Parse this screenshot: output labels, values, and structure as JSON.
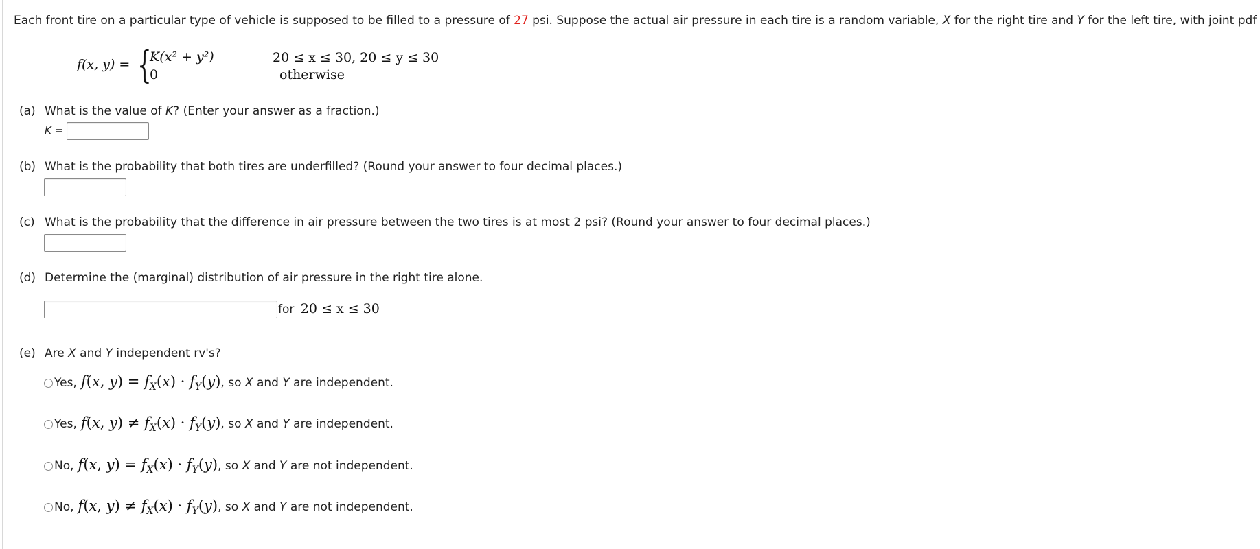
{
  "intro": {
    "before": "Each front tire on a particular type of vehicle is supposed to be filled to a pressure of ",
    "pressure": "27",
    "middle": " psi. Suppose the actual air pressure in each tire is a random variable, ",
    "var_x": "X",
    "after_x": " for the right tire and ",
    "var_y": "Y",
    "after_y": " for the left tire, with joint pdf"
  },
  "formula": {
    "lhs": "f(x, y) =",
    "case1_expr": "K(x² + y²)",
    "case1_cond": "20 ≤ x ≤ 30, 20 ≤ y ≤ 30",
    "case2_expr": "0",
    "case2_cond": "otherwise"
  },
  "parts": {
    "a": {
      "tag": "(a)",
      "q_before": "What is the value of ",
      "q_var": "K",
      "q_after": "? (Enter your answer as a fraction.)",
      "input_label_var": "K",
      "input_label_eq": " =",
      "value": ""
    },
    "b": {
      "tag": "(b)",
      "question": "What is the probability that both tires are underfilled? (Round your answer to four decimal places.)",
      "value": ""
    },
    "c": {
      "tag": "(c)",
      "question": "What is the probability that the difference in air pressure between the two tires is at most 2 psi? (Round your answer to four decimal places.)",
      "value": ""
    },
    "d": {
      "tag": "(d)",
      "question": "Determine the (marginal) distribution of air pressure in the right tire alone.",
      "value": "",
      "suffix_word": "for",
      "suffix_math": "20 ≤ x ≤ 30"
    },
    "e": {
      "tag": "(e)",
      "q_before": "Are ",
      "q_x": "X",
      "q_mid": " and ",
      "q_y": "Y",
      "q_after": " independent rv's?",
      "options": [
        {
          "lead": "Yes,",
          "math": "f(x, y) = f_X(x) · f_Y(y)",
          "rel": "=",
          "tail_before": ", so ",
          "x": "X",
          "and": " and ",
          "y": "Y",
          "tail_after": " are independent.",
          "selected": false
        },
        {
          "lead": "Yes,",
          "math": "f(x, y) ≠ f_X(x) · f_Y(y)",
          "rel": "≠",
          "tail_before": ", so ",
          "x": "X",
          "and": " and ",
          "y": "Y",
          "tail_after": " are independent.",
          "selected": false
        },
        {
          "lead": "No,",
          "math": "f(x, y) = f_X(x) · f_Y(y)",
          "rel": "=",
          "tail_before": ", so ",
          "x": "X",
          "and": " and ",
          "y": "Y",
          "tail_after": " are not independent.",
          "selected": false
        },
        {
          "lead": "No,",
          "math": "f(x, y) ≠ f_X(x) · f_Y(y)",
          "rel": "≠",
          "tail_before": ", so ",
          "x": "X",
          "and": " and ",
          "y": "Y",
          "tail_after": " are not independent.",
          "selected": false
        }
      ]
    }
  },
  "colors": {
    "highlight": "#e0201b",
    "text": "#222222",
    "input_border": "#8a8a8a"
  }
}
